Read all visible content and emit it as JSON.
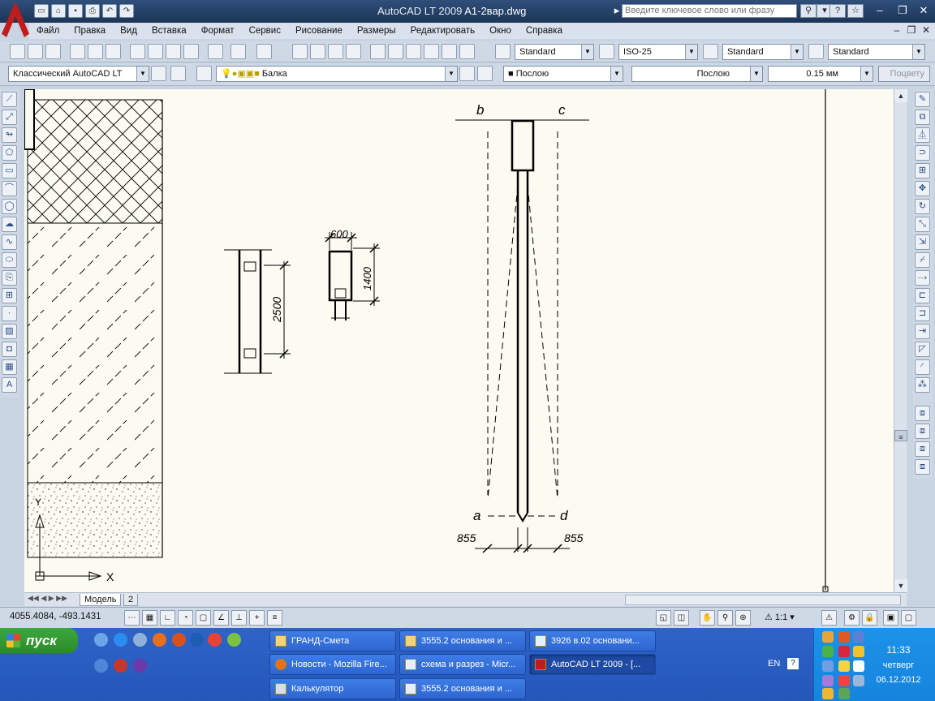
{
  "titlebar": {
    "app_title": "AutoCAD LT 2009",
    "file_name": "A1-2вар.dwg",
    "search_placeholder": "Введите ключевое слово или фразу"
  },
  "menu": [
    "Файл",
    "Правка",
    "Вид",
    "Вставка",
    "Формат",
    "Сервис",
    "Рисование",
    "Размеры",
    "Редактировать",
    "Окно",
    "Справка"
  ],
  "styles": {
    "text_style": "Standard",
    "dim_style": "ISO-25",
    "table_style": "Standard",
    "mleader_style": "Standard"
  },
  "layers": {
    "workspace": "Классический AutoCAD LT",
    "layer_name": "Балка",
    "color": "Послою",
    "linetype": "Послою",
    "lineweight": "0.15 мм",
    "plotstyle": "Поцвету"
  },
  "drawing": {
    "dim_600": "600",
    "dim_1400": "1400",
    "dim_2500": "2500",
    "label_b": "b",
    "label_c": "c",
    "label_a": "a",
    "label_d": "d",
    "dim_855_left": "855",
    "dim_855_right": "855",
    "ucs_x": "X",
    "ucs_y": "Y"
  },
  "tabs": {
    "model": "Модель",
    "layout": "2"
  },
  "status": {
    "coords": "4055.4084, -493.1431",
    "scale": "1:1"
  },
  "taskbar": {
    "start_label": "пуск",
    "tasks": [
      {
        "label": "ГРАНД-Смета"
      },
      {
        "label": "3555.2 основания и ..."
      },
      {
        "label": "3926 в.02 основани..."
      },
      {
        "label": "Новости - Mozilla Fire..."
      },
      {
        "label": "схема и разрез - Micr..."
      },
      {
        "label": "AutoCAD LT 2009 - [..."
      },
      {
        "label": "Калькулятор"
      },
      {
        "label": "3555.2 основания и ..."
      }
    ],
    "lang": "EN",
    "time": "11:33",
    "weekday": "четверг",
    "date": "06.12.2012"
  }
}
